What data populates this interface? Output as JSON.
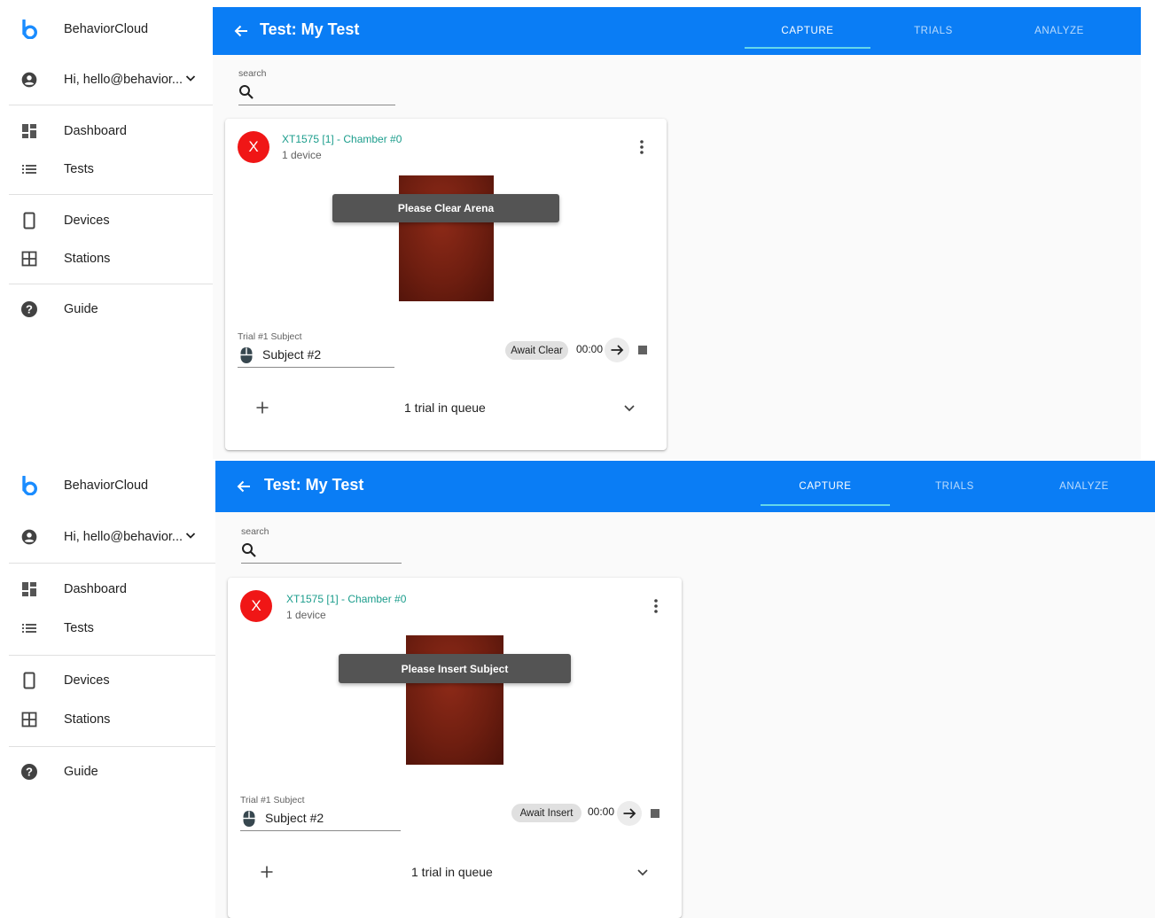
{
  "brand": {
    "name": "BehaviorCloud",
    "accent": "#0a7df5"
  },
  "user": {
    "greeting": "Hi, hello@behavior..."
  },
  "nav": {
    "dashboard": "Dashboard",
    "tests": "Tests",
    "devices": "Devices",
    "stations": "Stations",
    "guide": "Guide"
  },
  "header": {
    "title": "Test: My Test",
    "tabs": {
      "capture": "CAPTURE",
      "trials": "TRIALS",
      "analyze": "ANALYZE"
    },
    "active_tab": "CAPTURE"
  },
  "search": {
    "label": "search",
    "value": ""
  },
  "screens": [
    {
      "card": {
        "avatar": "X",
        "chamber": "XT1575 [1] - Chamber #0",
        "devices": "1 device",
        "overlay": "Please Clear Arena",
        "subject_label": "Trial #1 Subject",
        "subject": "Subject #2",
        "status": "Await Clear",
        "timer": "00:00",
        "queue": "1 trial in queue"
      }
    },
    {
      "card": {
        "avatar": "X",
        "chamber": "XT1575 [1] - Chamber #0",
        "devices": "1 device",
        "overlay": "Please Insert Subject",
        "subject_label": "Trial #1 Subject",
        "subject": "Subject #2",
        "status": "Await Insert",
        "timer": "00:00",
        "queue": "1 trial in queue"
      }
    }
  ]
}
